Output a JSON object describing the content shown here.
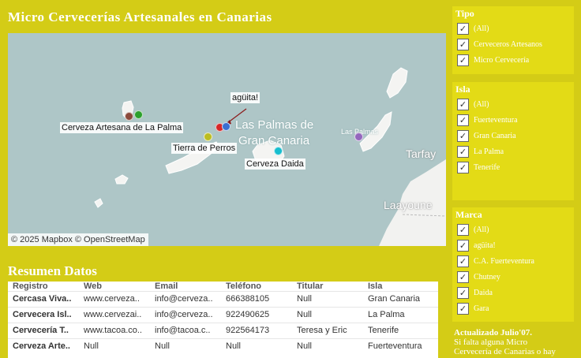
{
  "title": "Micro Cervecerías Artesanales en Canarias",
  "map": {
    "attribution": "© 2025 Mapbox © OpenStreetMap",
    "places": {
      "las_palmas": "Las Palmas de",
      "gran_canaria": "Gran Canaria",
      "las_palmas_small": "Las Palmas",
      "tarfaya": "Tarfay",
      "laayoune": "Laayoune"
    },
    "labels": {
      "aguita": "agüita!",
      "la_palma": "Cerveza Artesana de La Palma",
      "tierra": "Tierra de Perros",
      "daida": "Cerveza Daida"
    },
    "marker_colors": {
      "brown": "#8b4a3c",
      "green": "#2ca02c",
      "red": "#d62728",
      "blue": "#3b6fd1",
      "olive": "#bcbd22",
      "cyan": "#17becf",
      "purple": "#9467bd"
    }
  },
  "summary": {
    "title": "Resumen Datos",
    "headers": [
      "Registro",
      "Web",
      "Email",
      "Teléfono",
      "Titular",
      "Isla"
    ],
    "rows": [
      [
        "Cercasa Viva..",
        "www.cerveza..",
        "info@cerveza..",
        "666388105",
        "Null",
        "Gran Canaria"
      ],
      [
        "Cervecera Isl..",
        "www.cervezai..",
        "info@cerveza..",
        "922490625",
        "Null",
        "La Palma"
      ],
      [
        "Cervecería T..",
        "www.tacoa.co..",
        "info@tacoa.c..",
        "922564173",
        "Teresa y Eric",
        "Tenerife"
      ],
      [
        "Cerveza Arte..",
        "Null",
        "Null",
        "Null",
        "Null",
        "Fuerteventura"
      ]
    ]
  },
  "filters": {
    "tipo": {
      "title": "Tipo",
      "options": [
        "(All)",
        "Cerveceros Artesanos",
        "Micro Cervecería"
      ]
    },
    "isla": {
      "title": "Isla",
      "options": [
        "(All)",
        "Fuerteventura",
        "Gran Canaria",
        "La Palma",
        "Tenerife"
      ]
    },
    "marca": {
      "title": "Marca",
      "options": [
        "(All)",
        "agüita!",
        "C.A. Fuerteventura",
        "Chutney",
        "Daida",
        "Gara"
      ]
    },
    "check_glyph": "✓"
  },
  "note": {
    "heading": "Actualizado Julio'07.",
    "line1": "Si falta alguna Micro",
    "line2": "Cervecería de Canarias o hay"
  }
}
